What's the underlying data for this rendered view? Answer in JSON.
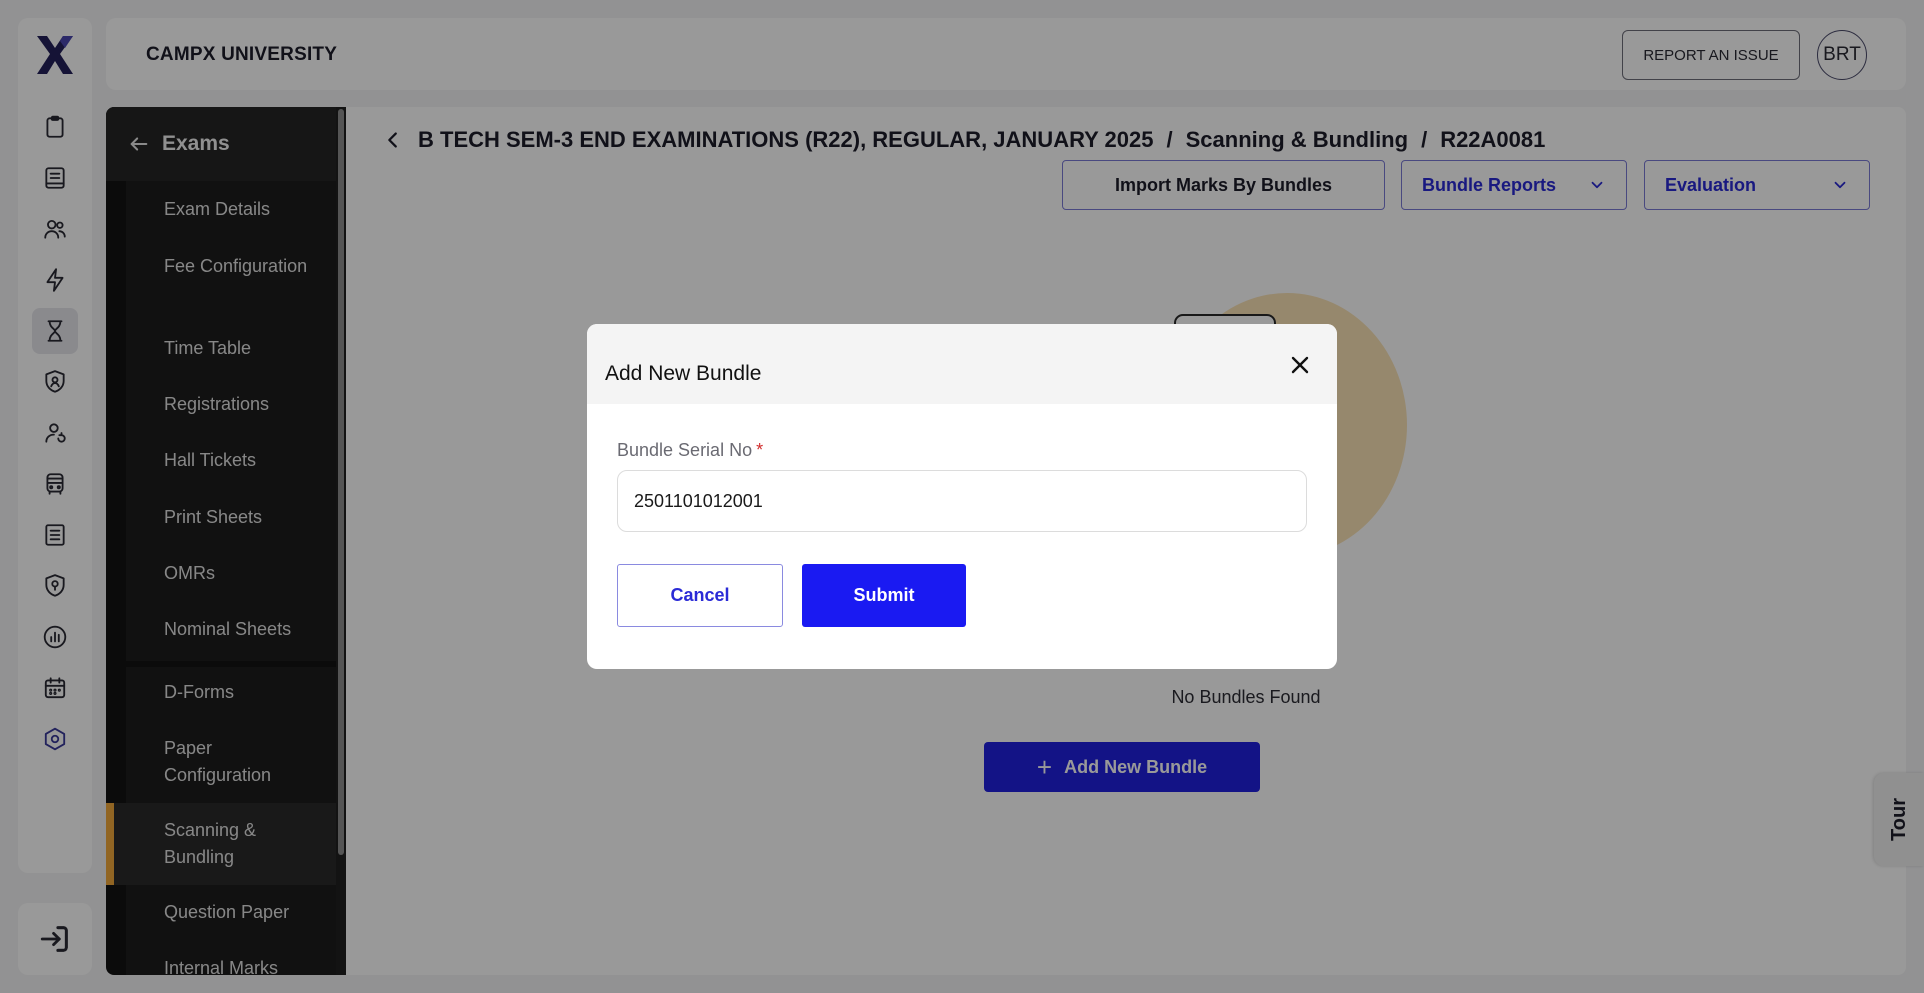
{
  "app": {
    "name": "CAMPX UNIVERSITY"
  },
  "rail": {
    "logo": "campx-logo",
    "items": [
      {
        "icon": "clipboard-icon",
        "active": false
      },
      {
        "icon": "book-icon",
        "active": false
      },
      {
        "icon": "users-icon",
        "active": false
      },
      {
        "icon": "lightning-icon",
        "active": false
      },
      {
        "icon": "hourglass-icon",
        "active": true
      },
      {
        "icon": "shield-user-icon",
        "active": false
      },
      {
        "icon": "user-refresh-icon",
        "active": false
      },
      {
        "icon": "bus-icon",
        "active": false
      },
      {
        "icon": "spreadsheet-icon",
        "active": false
      },
      {
        "icon": "shield-location-icon",
        "active": false
      },
      {
        "icon": "analytics-icon",
        "active": false
      },
      {
        "icon": "calendar-icon",
        "active": false
      },
      {
        "icon": "settings-hex-icon",
        "active": false
      }
    ],
    "logout_icon": "logout-icon"
  },
  "header": {
    "report_label": "REPORT AN ISSUE",
    "avatar_initials": "BRT"
  },
  "sidebar": {
    "title": "Exams",
    "items": [
      {
        "label": "Exam Details"
      },
      {
        "label": "Fee Configuration"
      },
      {
        "label": "Time Table"
      },
      {
        "label": "Registrations"
      },
      {
        "label": "Hall Tickets"
      },
      {
        "label": "Print Sheets"
      },
      {
        "label": "OMRs"
      },
      {
        "label": "Nominal Sheets"
      },
      {
        "label": "D-Forms"
      },
      {
        "label": "Paper Configuration"
      },
      {
        "label": "Scanning & Bundling",
        "active": true
      },
      {
        "label": "Question Paper"
      },
      {
        "label": "Internal Marks"
      }
    ]
  },
  "breadcrumb": {
    "exam": "B TECH SEM-3 END EXAMINATIONS (R22), REGULAR, JANUARY 2025",
    "separator": "/",
    "section": "Scanning & Bundling",
    "code": "R22A0081"
  },
  "actions": {
    "import_label": "Import Marks By Bundles",
    "reports_label": "Bundle Reports",
    "evaluation_label": "Evaluation"
  },
  "empty_state": {
    "message": "No Bundles Found",
    "add_label": "Add New Bundle"
  },
  "tour": {
    "label": "Tour"
  },
  "modal": {
    "title": "Add New Bundle",
    "field_label": "Bundle Serial No",
    "required_mark": "*",
    "field_value": "2501101012001",
    "cancel_label": "Cancel",
    "submit_label": "Submit"
  },
  "colors": {
    "primary": "#1a1af2",
    "primary_text": "#2a2ad6",
    "sidebar_bg": "#131313",
    "active_indicator": "#f2a93b",
    "required": "#d12b2b"
  }
}
